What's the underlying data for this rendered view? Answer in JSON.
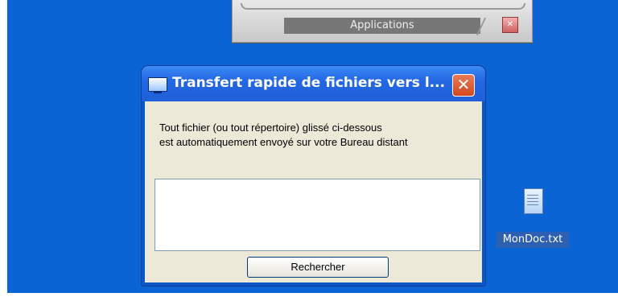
{
  "appbar": {
    "label": "Applications"
  },
  "dialog": {
    "title": "Transfert rapide de fichiers vers l...",
    "close_symbol": "✕",
    "message_line1": "Tout fichier (ou tout répertoire) glissé ci-dessous",
    "message_line2": "est automatiquement envoyé sur votre Bureau distant",
    "search_button": "Rechercher"
  },
  "desktop": {
    "file_icon_name": "MonDoc.txt"
  },
  "colors": {
    "desktop_bg": "#0a64d3",
    "dialog_face": "#ece9d8",
    "titlebar": "#2468e3",
    "close_button": "#d2471e"
  }
}
